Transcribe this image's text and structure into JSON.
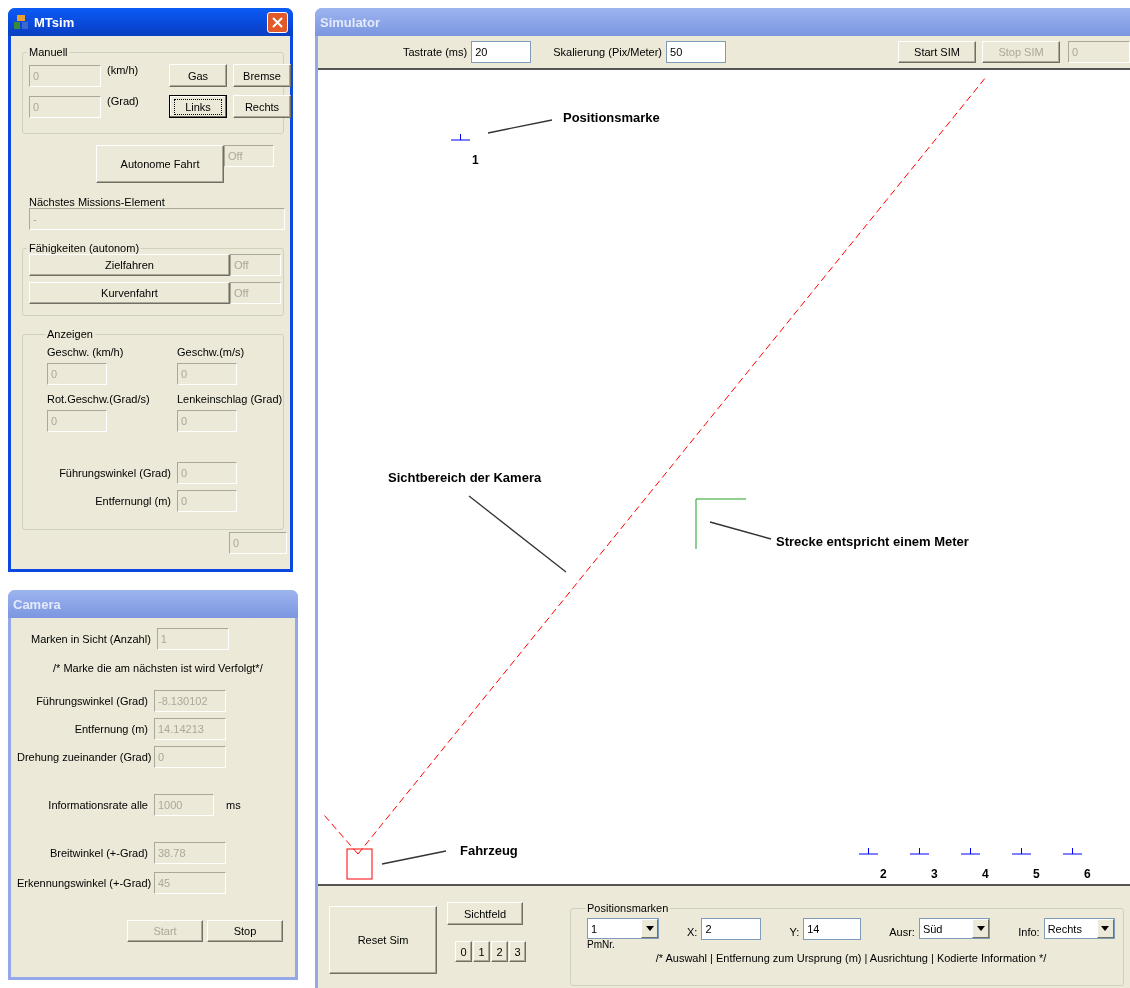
{
  "mtsim": {
    "title": "MTsim",
    "manual": {
      "legend": "Manuell",
      "rows": [
        {
          "value": "0",
          "unit": "(km/h)"
        },
        {
          "value": "0",
          "unit": "(Grad)"
        }
      ],
      "buttons": [
        {
          "label": "Gas",
          "focused": false
        },
        {
          "label": "Bremse",
          "focused": false
        },
        {
          "label": "Links",
          "focused": true
        },
        {
          "label": "Rechts",
          "focused": false
        }
      ]
    },
    "autonomous": {
      "button": "Autonome Fahrt",
      "status": "Off"
    },
    "next_mission": {
      "legend": "Nächstes Missions-Element",
      "value": "-"
    },
    "capabilities": {
      "legend": "Fähigkeiten (autonom)",
      "items": [
        {
          "label": "Zielfahren",
          "status": "Off"
        },
        {
          "label": "Kurvenfahrt",
          "status": "Off"
        }
      ]
    },
    "displays": {
      "legend": "Anzeigen",
      "grid": [
        {
          "label": "Geschw. (km/h)",
          "value": "0"
        },
        {
          "label": "Geschw.(m/s)",
          "value": "0"
        },
        {
          "label": "Rot.Geschw.(Grad/s)",
          "value": "0"
        },
        {
          "label": "Lenkeinschlag (Grad)",
          "value": "0"
        }
      ],
      "rows": [
        {
          "label": "Führungswinkel (Grad)",
          "value": "0"
        },
        {
          "label": "Entfernungl (m)",
          "value": "0"
        }
      ]
    },
    "footer_value": "0"
  },
  "camera": {
    "title": "Camera",
    "marks": {
      "label": "Marken in Sicht (Anzahl)",
      "value": "1"
    },
    "note": "/* Marke die am nächsten ist wird Verfolgt*/",
    "tracking": [
      {
        "label": "Führungswinkel (Grad)",
        "value": "-8.130102"
      },
      {
        "label": "Entfernung (m)",
        "value": "14.14213"
      },
      {
        "label": "Drehung zueinander (Grad)",
        "value": "0"
      }
    ],
    "rate": {
      "label": "Informationsrate alle",
      "value": "1000",
      "unit": "ms"
    },
    "angles": [
      {
        "label": "Breitwinkel (+-Grad)",
        "value": "38.78"
      },
      {
        "label": "Erkennungswinkel (+-Grad)",
        "value": "45"
      }
    ],
    "buttons": [
      {
        "label": "Start",
        "disabled": true
      },
      {
        "label": "Stop",
        "disabled": false
      }
    ]
  },
  "simulator": {
    "title": "Simulator",
    "fields": [
      {
        "label": "Tastrate (ms)",
        "value": "20"
      },
      {
        "label": "Skalierung (Pix/Meter)",
        "value": "50"
      }
    ],
    "buttons": [
      {
        "label": "Start SIM",
        "disabled": false
      },
      {
        "label": "Stop SIM",
        "disabled": true
      }
    ],
    "counter": "0",
    "canvas": {
      "markers": [
        {
          "number": "1"
        },
        {
          "number": "2"
        },
        {
          "number": "3"
        },
        {
          "number": "4"
        },
        {
          "number": "5"
        },
        {
          "number": "6"
        }
      ],
      "annotations": [
        "Positionsmarke",
        "Sichtbereich der Kamera",
        "Strecke entspricht einem Meter",
        "Fahrzeug"
      ]
    },
    "reset": "Reset Sim",
    "view_field": "Sichtfeld",
    "view_buttons": [
      "0",
      "1",
      "2",
      "3"
    ],
    "position_marks": {
      "legend": "Positionsmarken",
      "pm": {
        "value": "1",
        "label": "PmNr."
      },
      "x": {
        "label": "X:",
        "value": "2"
      },
      "y": {
        "label": "Y:",
        "value": "14"
      },
      "orientation": {
        "label": "Ausr:",
        "value": "Süd"
      },
      "info": {
        "label": "Info:",
        "value": "Rechts"
      },
      "note": "/* Auswahl | Entfernung zum Ursprung (m) | Ausrichtung | Kodierte Information */"
    }
  }
}
